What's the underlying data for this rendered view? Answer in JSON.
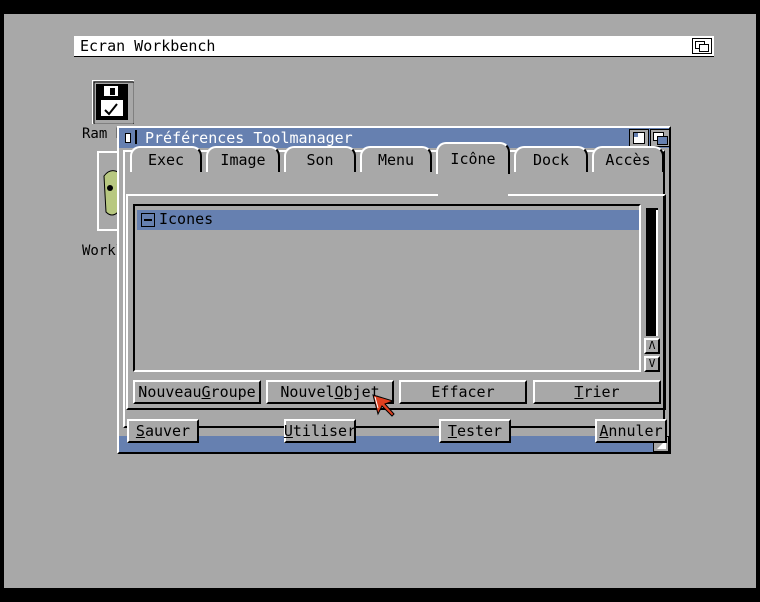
{
  "screen": {
    "title": "Ecran Workbench"
  },
  "desktop_icons": [
    {
      "label": "Ram Disk",
      "icon": "floppy-disk-icon"
    },
    {
      "label": "Workl",
      "icon": "workbench-disk-icon"
    }
  ],
  "window": {
    "title": "Préférences Toolmanager",
    "tabs": [
      "Exec",
      "Image",
      "Son",
      "Menu",
      "Icône",
      "Dock",
      "Accès"
    ],
    "active_tab": "Icône",
    "list": {
      "items": [
        "Icones"
      ]
    },
    "list_buttons": [
      {
        "label_pre": "Nouveau ",
        "label_u": "G",
        "label_post": "roupe"
      },
      {
        "label_pre": "Nouvel ",
        "label_u": "O",
        "label_post": "bjet"
      },
      {
        "label_pre": "Effacer",
        "label_u": "",
        "label_post": ""
      },
      {
        "label_pre": "",
        "label_u": "T",
        "label_post": "rier"
      }
    ],
    "footer_buttons": [
      {
        "label_u": "S",
        "label_post": "auver"
      },
      {
        "label_u": "U",
        "label_post": "tiliser"
      },
      {
        "label_u": "T",
        "label_post": "ester"
      },
      {
        "label_u": "A",
        "label_post": "nnuler"
      }
    ]
  },
  "colors": {
    "background": "#a8a8a8",
    "title_blue": "#6680b0",
    "pointer_red": "#e04020"
  }
}
